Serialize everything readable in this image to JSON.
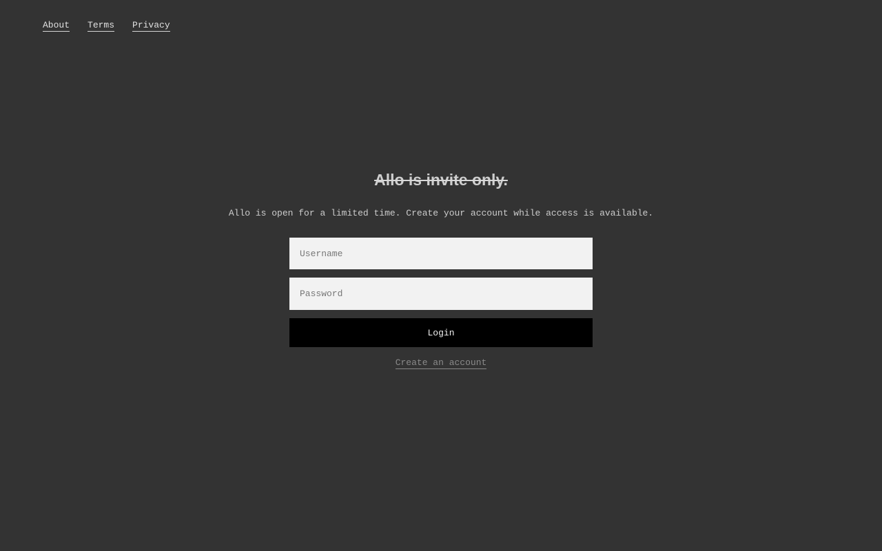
{
  "nav": {
    "links": [
      {
        "label": "About"
      },
      {
        "label": "Terms"
      },
      {
        "label": "Privacy"
      }
    ]
  },
  "main": {
    "headline": "Allo is invite only.",
    "subtitle": "Allo is open for a limited time. Create your account while access is available.",
    "username": {
      "placeholder": "Username",
      "value": ""
    },
    "password": {
      "placeholder": "Password",
      "value": ""
    },
    "login_label": "Login",
    "create_account_label": "Create an account"
  },
  "colors": {
    "background": "#333333",
    "input_background": "#f2f2f2",
    "button_background": "#000000",
    "link_muted": "#8a8a8a"
  }
}
